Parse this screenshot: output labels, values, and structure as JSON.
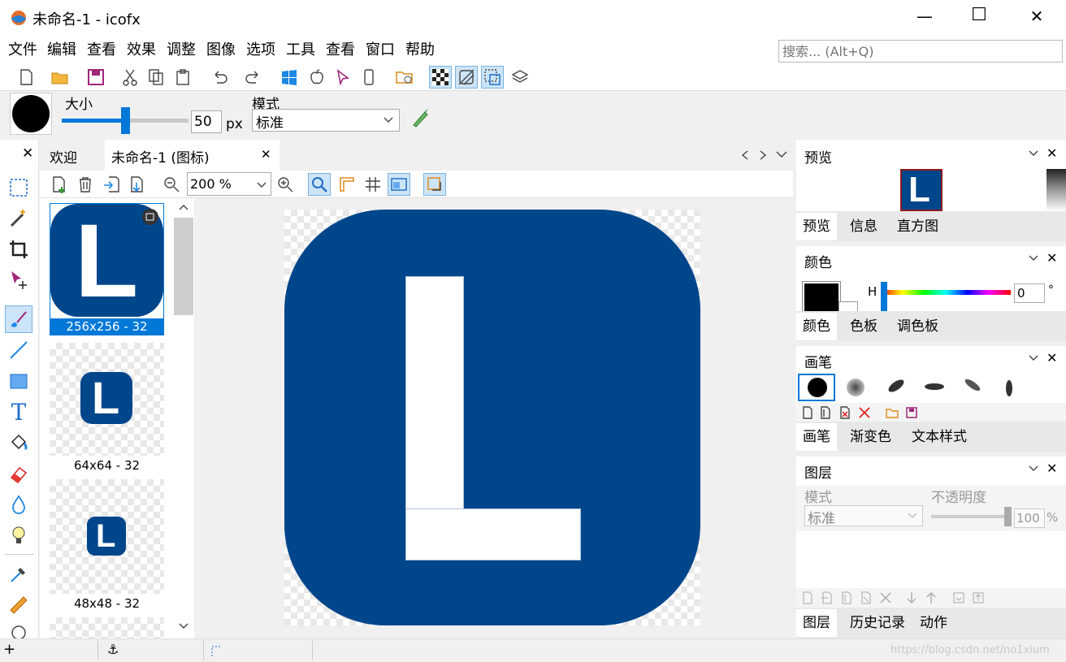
{
  "window": {
    "title": "未命名-1 - icofx",
    "minimize": "—",
    "maximize": "☐",
    "close": "✕"
  },
  "menu": {
    "items": [
      "文件",
      "编辑",
      "查看",
      "效果",
      "调整",
      "图像",
      "选项",
      "工具",
      "查看",
      "窗口",
      "帮助"
    ]
  },
  "search": {
    "placeholder": "搜索... (Alt+Q)"
  },
  "options": {
    "size_label": "大小",
    "size_value": "50",
    "size_unit": "px",
    "size_fraction": 0.5,
    "mode_label": "模式",
    "mode_value": "标准"
  },
  "doc_tabs": {
    "welcome": "欢迎",
    "current": "未命名-1 (图标)",
    "close": "✕"
  },
  "doc_toolbar": {
    "zoom_value": "200 %"
  },
  "thumbnails": [
    {
      "label": "256x256 - 32",
      "selected": true
    },
    {
      "label": "64x64 - 32",
      "selected": false
    },
    {
      "label": "48x48 - 32",
      "selected": false
    }
  ],
  "canvas": {
    "letter": "L",
    "fill_color": "#00468b"
  },
  "preview_panel": {
    "title": "预览",
    "tabs": [
      "预览",
      "信息",
      "直方图"
    ],
    "letter": "L"
  },
  "color_panel": {
    "title": "颜色",
    "h_label": "H",
    "h_value": "0",
    "h_unit": "°",
    "tabs": [
      "颜色",
      "色板",
      "调色板"
    ]
  },
  "brush_panel": {
    "title": "画笔",
    "tabs": [
      "画笔",
      "渐变色",
      "文本样式"
    ]
  },
  "layers_panel": {
    "title": "图层",
    "mode_label": "模式",
    "mode_value": "标准",
    "opacity_label": "不透明度",
    "opacity_value": "100",
    "opacity_unit": "%",
    "tabs": [
      "图层",
      "历史记录",
      "动作"
    ]
  },
  "watermark": "https://blog.csdn.net/no1xium",
  "colors": {
    "accent": "#0078d7",
    "icon_blue": "#00468b",
    "selection": "#cce4f7"
  }
}
